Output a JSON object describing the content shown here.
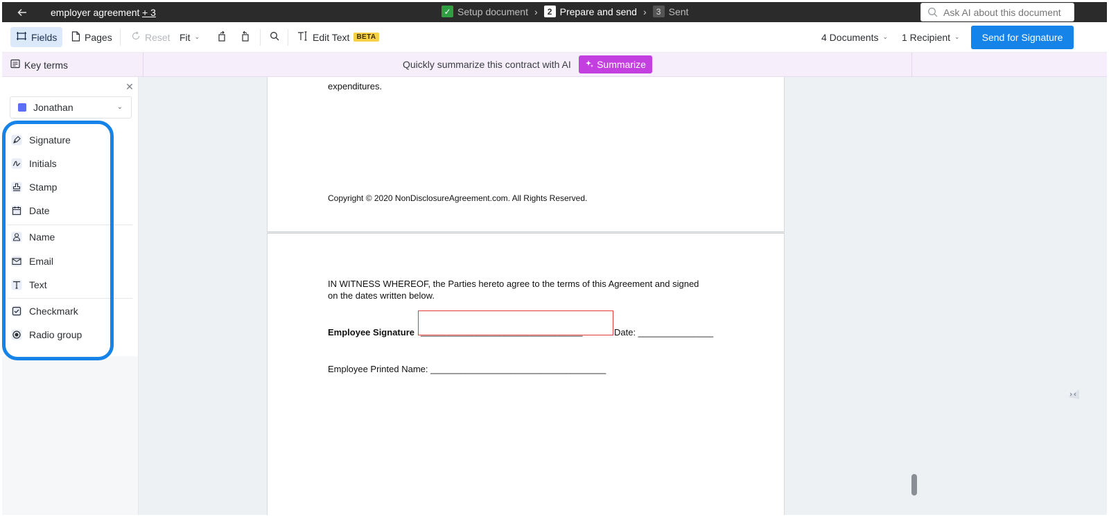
{
  "topbar": {
    "document_title": "employer agreement",
    "document_extra": "+ 3",
    "steps": [
      {
        "number": "✓",
        "label": "Setup document",
        "state": "done"
      },
      {
        "number": "2",
        "label": "Prepare and send",
        "state": "current"
      },
      {
        "number": "3",
        "label": "Sent",
        "state": "future"
      }
    ]
  },
  "toolbar": {
    "fields_label": "Fields",
    "pages_label": "Pages",
    "reset_label": "Reset",
    "fit_label": "Fit",
    "edit_text_label": "Edit Text",
    "beta_label": "BETA",
    "documents_label": "4 Documents",
    "recipients_label": "1 Recipient",
    "send_label": "Send for Signature"
  },
  "aibar": {
    "key_terms_label": "Key terms",
    "prompt_text": "Quickly summarize this contract with AI",
    "summarize_label": "Summarize",
    "ask_placeholder": "Ask AI about this document"
  },
  "left_panel": {
    "recipient_name": "Jonathan",
    "recipient_color": "#5b6ef5",
    "fields": [
      {
        "label": "Signature",
        "icon": "pen-nib-icon"
      },
      {
        "label": "Initials",
        "icon": "initials-icon"
      },
      {
        "label": "Stamp",
        "icon": "stamp-icon"
      },
      {
        "label": "Date",
        "icon": "calendar-icon"
      },
      {
        "label": "Name",
        "icon": "user-icon"
      },
      {
        "label": "Email",
        "icon": "envelope-icon"
      },
      {
        "label": "Text",
        "icon": "text-icon"
      },
      {
        "label": "Checkmark",
        "icon": "checkbox-icon"
      },
      {
        "label": "Radio group",
        "icon": "radio-icon"
      }
    ]
  },
  "document": {
    "page1_partial_line": "expenditures.",
    "page1_copyright": "Copyright © 2020 NonDisclosureAgreement.com. All Rights Reserved.",
    "witness_line1": "IN WITNESS WHEREOF, the Parties hereto agree to the terms of this Agreement and signed",
    "witness_line2": "on the dates written below.",
    "employee_signature_label": "Employee Signature",
    "signature_underline": "___________________________________",
    "date_label": "Date: _______________",
    "printed_name_line": "Employee Printed Name: ___________________________________"
  },
  "colors": {
    "accent": "#1583e8",
    "summarize": "#c43fe0",
    "signature_box": "#e03b3b",
    "step_done": "#2ea043"
  }
}
